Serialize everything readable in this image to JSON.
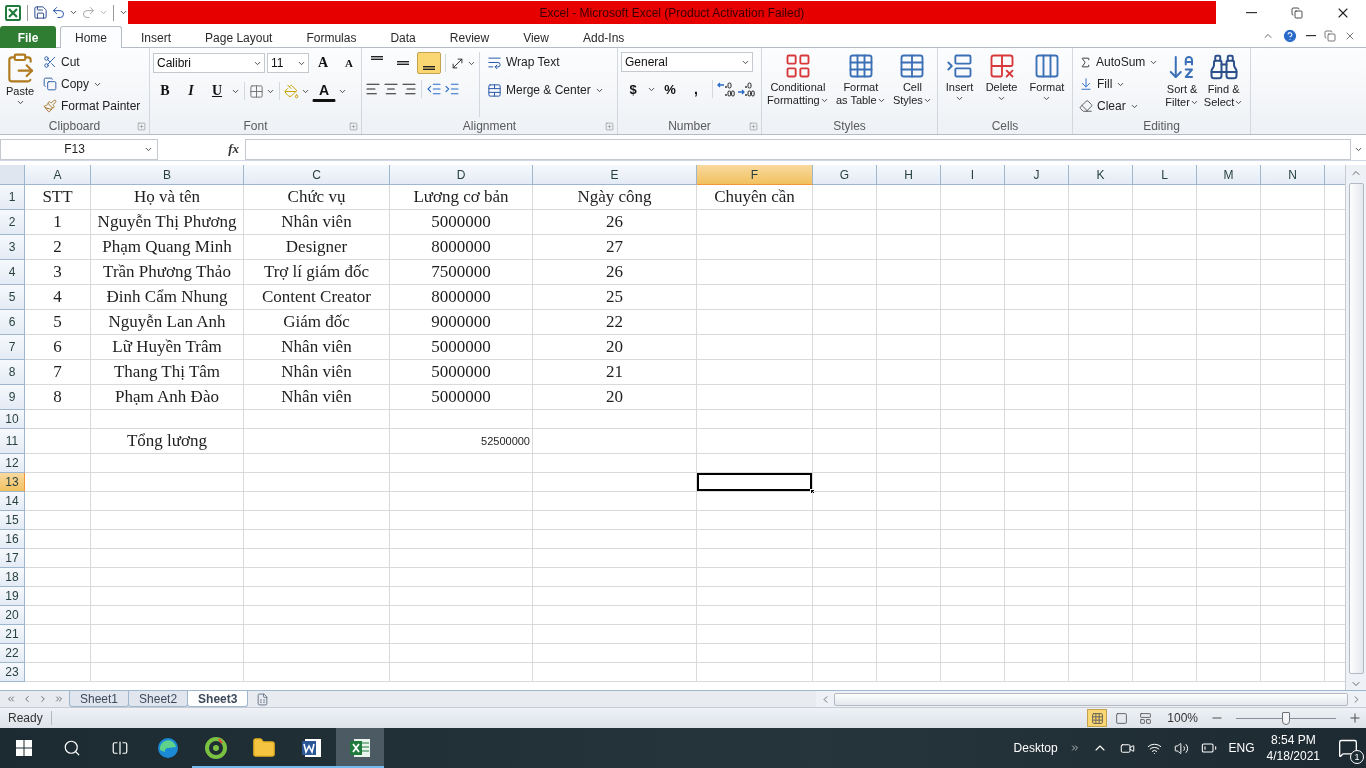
{
  "title_bar": {
    "title": "Excel  -  Microsoft Excel (Product Activation Failed)"
  },
  "tabs": [
    {
      "label": "File",
      "kind": "file",
      "selected": false
    },
    {
      "label": "Home",
      "kind": "tab",
      "selected": true
    },
    {
      "label": "Insert",
      "kind": "tab",
      "selected": false
    },
    {
      "label": "Page Layout",
      "kind": "tab",
      "selected": false
    },
    {
      "label": "Formulas",
      "kind": "tab",
      "selected": false
    },
    {
      "label": "Data",
      "kind": "tab",
      "selected": false
    },
    {
      "label": "Review",
      "kind": "tab",
      "selected": false
    },
    {
      "label": "View",
      "kind": "tab",
      "selected": false
    },
    {
      "label": "Add-Ins",
      "kind": "tab",
      "selected": false
    }
  ],
  "ribbon": {
    "clipboard": {
      "label": "Clipboard",
      "paste": "Paste",
      "cut": "Cut",
      "copy": "Copy",
      "format_painter": "Format Painter"
    },
    "font": {
      "label": "Font",
      "font_name": "Calibri",
      "font_size": "11",
      "grow": "A",
      "shrink": "A",
      "bold": "B",
      "italic": "I",
      "underline": "U",
      "font_color": "A"
    },
    "alignment": {
      "label": "Alignment",
      "vertical": [
        {
          "selected": false
        },
        {
          "selected": false
        },
        {
          "selected": true
        }
      ],
      "wrap_text": "Wrap Text",
      "merge_center": "Merge & Center"
    },
    "number": {
      "label": "Number",
      "format": "General",
      "currency": "$",
      "percent": "%",
      "comma": ","
    },
    "styles": {
      "label": "Styles",
      "items": [
        {
          "line1": "Conditional",
          "line2": "Formatting"
        },
        {
          "line1": "Format",
          "line2": "as Table"
        },
        {
          "line1": "Cell",
          "line2": "Styles"
        }
      ]
    },
    "cells": {
      "label": "Cells",
      "items": [
        "Insert",
        "Delete",
        "Format"
      ]
    },
    "editing": {
      "label": "Editing",
      "autosum": "AutoSum",
      "fill": "Fill",
      "clear": "Clear",
      "sort": {
        "line1": "Sort &",
        "line2": "Filter"
      },
      "find": {
        "line1": "Find &",
        "line2": "Select"
      }
    }
  },
  "formula_bar": {
    "name_box": "F13",
    "fx": "fx"
  },
  "sheet": {
    "columns": [
      {
        "label": "A",
        "selected": false
      },
      {
        "label": "B",
        "selected": false
      },
      {
        "label": "C",
        "selected": false
      },
      {
        "label": "D",
        "selected": false
      },
      {
        "label": "E",
        "selected": false
      },
      {
        "label": "F",
        "selected": true
      },
      {
        "label": "G",
        "selected": false
      },
      {
        "label": "H",
        "selected": false
      },
      {
        "label": "I",
        "selected": false
      },
      {
        "label": "J",
        "selected": false
      },
      {
        "label": "K",
        "selected": false
      },
      {
        "label": "L",
        "selected": false
      },
      {
        "label": "M",
        "selected": false
      },
      {
        "label": "N",
        "selected": false
      }
    ],
    "rows": [
      {
        "number": "1",
        "selected": false,
        "cells": [
          {
            "text": "STT",
            "kind": "formatted"
          },
          {
            "text": "Họ và tên",
            "kind": "formatted"
          },
          {
            "text": "Chức vụ",
            "kind": "formatted"
          },
          {
            "text": "Lương cơ bản",
            "kind": "formatted"
          },
          {
            "text": "Ngày công",
            "kind": "formatted"
          },
          {
            "text": "Chuyên cần",
            "kind": "formatted"
          }
        ]
      },
      {
        "number": "2",
        "selected": false,
        "cells": [
          {
            "text": "1",
            "kind": "formatted"
          },
          {
            "text": "Nguyễn Thị Phương",
            "kind": "formatted"
          },
          {
            "text": "Nhân viên",
            "kind": "formatted"
          },
          {
            "text": "5000000",
            "kind": "formatted"
          },
          {
            "text": "26",
            "kind": "formatted"
          }
        ]
      },
      {
        "number": "3",
        "selected": false,
        "cells": [
          {
            "text": "2",
            "kind": "formatted"
          },
          {
            "text": "Phạm Quang Minh",
            "kind": "formatted"
          },
          {
            "text": "Designer",
            "kind": "formatted"
          },
          {
            "text": "8000000",
            "kind": "formatted"
          },
          {
            "text": "27",
            "kind": "formatted"
          }
        ]
      },
      {
        "number": "4",
        "selected": false,
        "cells": [
          {
            "text": "3",
            "kind": "formatted"
          },
          {
            "text": "Trần Phương Thảo",
            "kind": "formatted"
          },
          {
            "text": "Trợ lí giám đốc",
            "kind": "formatted"
          },
          {
            "text": "7500000",
            "kind": "formatted"
          },
          {
            "text": "26",
            "kind": "formatted"
          }
        ]
      },
      {
        "number": "5",
        "selected": false,
        "cells": [
          {
            "text": "4",
            "kind": "formatted"
          },
          {
            "text": "Đinh Cẩm Nhung",
            "kind": "formatted"
          },
          {
            "text": "Content Creator",
            "kind": "formatted"
          },
          {
            "text": "8000000",
            "kind": "formatted"
          },
          {
            "text": "25",
            "kind": "formatted"
          }
        ]
      },
      {
        "number": "6",
        "selected": false,
        "cells": [
          {
            "text": "5",
            "kind": "formatted"
          },
          {
            "text": "Nguyễn Lan Anh",
            "kind": "formatted"
          },
          {
            "text": "Giám đốc",
            "kind": "formatted"
          },
          {
            "text": "9000000",
            "kind": "formatted"
          },
          {
            "text": "22",
            "kind": "formatted"
          }
        ]
      },
      {
        "number": "7",
        "selected": false,
        "cells": [
          {
            "text": "6",
            "kind": "formatted"
          },
          {
            "text": "Lữ Huyền Trâm",
            "kind": "formatted"
          },
          {
            "text": "Nhân viên",
            "kind": "formatted"
          },
          {
            "text": "5000000",
            "kind": "formatted"
          },
          {
            "text": "20",
            "kind": "formatted"
          }
        ]
      },
      {
        "number": "8",
        "selected": false,
        "cells": [
          {
            "text": "7",
            "kind": "formatted"
          },
          {
            "text": "Thang Thị Tâm",
            "kind": "formatted"
          },
          {
            "text": "Nhân viên",
            "kind": "formatted"
          },
          {
            "text": "5000000",
            "kind": "formatted"
          },
          {
            "text": "21",
            "kind": "formatted"
          }
        ]
      },
      {
        "number": "9",
        "selected": false,
        "cells": [
          {
            "text": "8",
            "kind": "formatted"
          },
          {
            "text": "Phạm Anh Đào",
            "kind": "formatted"
          },
          {
            "text": "Nhân viên",
            "kind": "formatted"
          },
          {
            "text": "5000000",
            "kind": "formatted"
          },
          {
            "text": "20",
            "kind": "formatted"
          }
        ]
      },
      {
        "number": "10",
        "selected": false
      },
      {
        "number": "11",
        "selected": false,
        "cells": [
          null,
          {
            "text": "Tổng lương",
            "kind": "formatted"
          },
          null,
          {
            "text": "52500000",
            "kind": "plain"
          }
        ]
      },
      {
        "number": "12",
        "selected": false
      },
      {
        "number": "13",
        "selected": true
      },
      {
        "number": "14",
        "selected": false
      },
      {
        "number": "15",
        "selected": false
      },
      {
        "number": "16",
        "selected": false
      },
      {
        "number": "17",
        "selected": false
      },
      {
        "number": "18",
        "selected": false
      },
      {
        "number": "19",
        "selected": false
      },
      {
        "number": "20",
        "selected": false
      },
      {
        "number": "21",
        "selected": false
      },
      {
        "number": "22",
        "selected": false
      },
      {
        "number": "23",
        "selected": false
      }
    ]
  },
  "sheet_tabs": [
    {
      "label": "Sheet1",
      "selected": false
    },
    {
      "label": "Sheet2",
      "selected": false
    },
    {
      "label": "Sheet3",
      "selected": true
    }
  ],
  "status_bar": {
    "status": "Ready",
    "views": [
      {
        "selected": true
      },
      {
        "selected": false
      },
      {
        "selected": false
      }
    ],
    "zoom": "100%",
    "zoom_slider": {
      "level": 0.5
    }
  },
  "taskbar": {
    "apps": [
      {
        "running": false,
        "selected": false
      },
      {
        "running": true,
        "selected": false
      },
      {
        "running": true,
        "selected": false
      },
      {
        "running": true,
        "selected": false
      },
      {
        "running": true,
        "selected": true
      }
    ],
    "desktop": "Desktop",
    "language": "ENG",
    "time": "8:54 PM",
    "date": "4/18/2021",
    "notifications": "1"
  }
}
